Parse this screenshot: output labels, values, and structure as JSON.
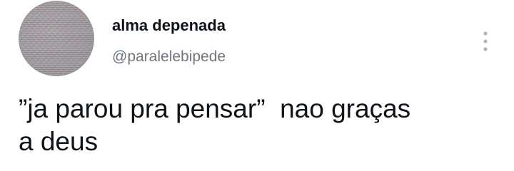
{
  "tweet": {
    "display_name": "alma depenada",
    "handle": "@paralelebipede",
    "text": "”ja parou pra pensar”  nao graças\na deus",
    "avatar": "avatar-image"
  },
  "icons": {
    "more": "more-vertical-icon"
  },
  "colors": {
    "text": "#0f1419",
    "secondary": "#6e7780",
    "icon": "#aab8c2",
    "background": "#ffffff"
  }
}
